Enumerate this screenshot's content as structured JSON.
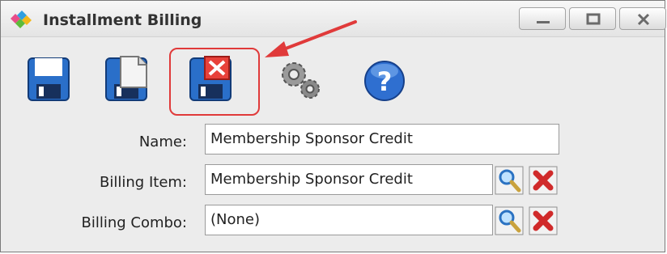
{
  "window": {
    "title": "Installment Billing"
  },
  "toolbar": {
    "buttons": [
      {
        "icon": "save-icon"
      },
      {
        "icon": "save-copy-icon"
      },
      {
        "icon": "delete-record-icon"
      },
      {
        "icon": "settings-gears-icon"
      },
      {
        "icon": "help-icon"
      }
    ],
    "highlight_color": "#e03a3a"
  },
  "form": {
    "name": {
      "label": "Name:",
      "value": "Membership Sponsor Credit"
    },
    "billing_item": {
      "label": "Billing Item:",
      "value": "Membership Sponsor Credit"
    },
    "billing_combo": {
      "label": "Billing Combo:",
      "value": "(None)"
    }
  }
}
